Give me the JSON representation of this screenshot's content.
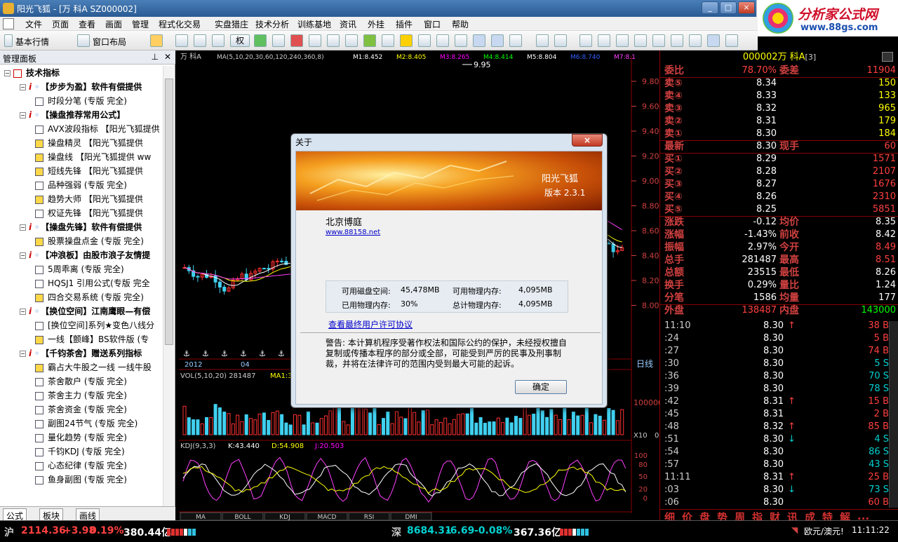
{
  "window": {
    "title": "阳光飞狐 - [万 科A SZ000002]",
    "controls": [
      "_",
      "□",
      "×"
    ]
  },
  "logo": {
    "text": "分析家公式网",
    "url": "www.88gs.com"
  },
  "menu": [
    "文件",
    "页面",
    "查看",
    "画面",
    "管理",
    "程式化交易",
    "实盘猎庄",
    "技术分析",
    "训练基地",
    "资讯",
    "外挂",
    "插件",
    "窗口",
    "帮助"
  ],
  "toolbar": {
    "market": "基本行情",
    "layout": "窗口布局",
    "quan": "权"
  },
  "panel": {
    "title": "管理面板",
    "tabs": [
      "公式",
      "板块",
      "画线"
    ],
    "tree": [
      {
        "lvl": 0,
        "type": "root",
        "text": "技术指标"
      },
      {
        "lvl": 1,
        "type": "group",
        "text": "【步步为盈】软件有偿提供"
      },
      {
        "lvl": 2,
        "type": "item",
        "text": "时段分笔  (专版 完全)"
      },
      {
        "lvl": 1,
        "type": "group",
        "text": "【操盘推荐常用公式】"
      },
      {
        "lvl": 2,
        "type": "item",
        "text": "AVX波段指标  【阳光飞狐提供"
      },
      {
        "lvl": 2,
        "type": "itemy",
        "text": "操盘精灵  【阳光飞狐提供 "
      },
      {
        "lvl": 2,
        "type": "itemy",
        "text": "操盘线  【阳光飞狐提供 ww"
      },
      {
        "lvl": 2,
        "type": "itemy",
        "text": "短线先锋  【阳光飞狐提供 "
      },
      {
        "lvl": 2,
        "type": "item",
        "text": "品种强弱  (专版 完全)"
      },
      {
        "lvl": 2,
        "type": "itemy",
        "text": "趋势大师  【阳光飞狐提供 "
      },
      {
        "lvl": 2,
        "type": "item",
        "text": "权证先锋  【阳光飞狐提供 "
      },
      {
        "lvl": 1,
        "type": "group",
        "text": "【操盘先锋】软件有偿提供"
      },
      {
        "lvl": 2,
        "type": "itemy",
        "text": "股票操盘点金  (专版 完全)"
      },
      {
        "lvl": 1,
        "type": "group",
        "text": "【冲浪板】由股市浪子友情提"
      },
      {
        "lvl": 2,
        "type": "item",
        "text": "5周乖离  (专版 完全)"
      },
      {
        "lvl": 2,
        "type": "item",
        "text": "HQSJ1  引用公式(专版 完全"
      },
      {
        "lvl": 2,
        "type": "itemy",
        "text": "四合交易系统  (专版 完全)"
      },
      {
        "lvl": 1,
        "type": "group",
        "text": "【换位空间】江南鹰眼—有偿"
      },
      {
        "lvl": 2,
        "type": "item",
        "text": "[换位空间]系列★变色八线分"
      },
      {
        "lvl": 2,
        "type": "itemy",
        "text": "一线【颤峰】BS软件版  (专"
      },
      {
        "lvl": 1,
        "type": "group",
        "text": "【千钧茶舍】赠送系列指标"
      },
      {
        "lvl": 2,
        "type": "itemy",
        "text": "霸占大牛股之一线  一线牛股"
      },
      {
        "lvl": 2,
        "type": "item",
        "text": "茶舍散户  (专版 完全)"
      },
      {
        "lvl": 2,
        "type": "item",
        "text": "茶舍主力  (专版 完全)"
      },
      {
        "lvl": 2,
        "type": "item",
        "text": "茶舍资金  (专版 完全)"
      },
      {
        "lvl": 2,
        "type": "item",
        "text": "副图24节气  (专版 完全)"
      },
      {
        "lvl": 2,
        "type": "item",
        "text": "量化趋势  (专版 完全)"
      },
      {
        "lvl": 2,
        "type": "item",
        "text": "千钧KDJ  (专版 完全)"
      },
      {
        "lvl": 2,
        "type": "item",
        "text": "心态纪律  (专版 完全)"
      },
      {
        "lvl": 2,
        "type": "item",
        "text": "鱼身副图  (专版 完全)"
      }
    ]
  },
  "chart": {
    "stock": "万  科A",
    "ma_label": "MA(5,10,20,30,60,120,240,360,8)",
    "ma": [
      {
        "t": "M1:8.452",
        "c": "#ffffff"
      },
      {
        "t": "M2:8.405",
        "c": "#ffff00"
      },
      {
        "t": "M3:8.265",
        "c": "#ff00ff"
      },
      {
        "t": "M4:8.414",
        "c": "#00ff00"
      },
      {
        "t": "M5:8.804",
        "c": "#ffffff"
      },
      {
        "t": "M6:8.740",
        "c": "#3060ff"
      },
      {
        "t": "M7:8.1",
        "c": "#ff40ff"
      }
    ],
    "high_label": "9.95",
    "price_axis": [
      "9.80",
      "9.60",
      "9.40",
      "9.20",
      "9.00",
      "8.80",
      "8.60",
      "8.40",
      "8.20",
      "8.00"
    ],
    "date_labels": [
      "2012",
      "04"
    ],
    "period": "日线",
    "vol_label": "VOL(5,10,20)  281487",
    "vol_ma1": "MA1:3",
    "vol_axis": "100000",
    "vol_unit": "X10",
    "vol_zero": "0",
    "kdj_label": "KDJ(9,3,3)",
    "kdj": [
      {
        "t": "K:43.440",
        "c": "#ffffff"
      },
      {
        "t": "D:54.908",
        "c": "#ffff00"
      },
      {
        "t": "J:20.503",
        "c": "#ff00ff"
      }
    ],
    "kdj_axis": [
      "100",
      "80",
      "50",
      "20",
      "0"
    ],
    "bottom_tabs": [
      "MA",
      "BOLL",
      "KDJ",
      "MACD",
      "RSI",
      "DMI"
    ]
  },
  "quote": {
    "title": "000002万 科A",
    "title_suffix": "[3]",
    "rows": [
      {
        "l": "委比",
        "v": "78.70%",
        "c": "#ff4040",
        "l2": "委差",
        "v2": "11904",
        "c2": "#ff4040"
      },
      {
        "l": "卖⑤",
        "v": "8.34",
        "c": "#ffffff",
        "v2": "150",
        "c2": "#ffff00"
      },
      {
        "l": "卖④",
        "v": "8.33",
        "c": "#ffffff",
        "v2": "133",
        "c2": "#ffff00"
      },
      {
        "l": "卖③",
        "v": "8.32",
        "c": "#ffffff",
        "v2": "965",
        "c2": "#ffff00"
      },
      {
        "l": "卖②",
        "v": "8.31",
        "c": "#ffffff",
        "v2": "179",
        "c2": "#ffff00"
      },
      {
        "l": "卖①",
        "v": "8.30",
        "c": "#ffffff",
        "v2": "184",
        "c2": "#ffff00"
      },
      {
        "l": "最新",
        "v": "8.30",
        "c": "#ffffff",
        "l2": "现手",
        "v2": "60",
        "c2": "#ff4040"
      },
      {
        "l": "买①",
        "v": "8.29",
        "c": "#ffffff",
        "v2": "1571",
        "c2": "#ff4040"
      },
      {
        "l": "买②",
        "v": "8.28",
        "c": "#ffffff",
        "v2": "2107",
        "c2": "#ff4040"
      },
      {
        "l": "买③",
        "v": "8.27",
        "c": "#ffffff",
        "v2": "1676",
        "c2": "#ff4040"
      },
      {
        "l": "买④",
        "v": "8.26",
        "c": "#ffffff",
        "v2": "2310",
        "c2": "#ff4040"
      },
      {
        "l": "买⑤",
        "v": "8.25",
        "c": "#ffffff",
        "v2": "5851",
        "c2": "#ff4040"
      },
      {
        "l": "涨跌",
        "v": "-0.12",
        "c": "#ffffff",
        "l2": "均价",
        "v2": "8.35",
        "c2": "#ffffff"
      },
      {
        "l": "涨幅",
        "v": "-1.43%",
        "c": "#ffffff",
        "l2": "前收",
        "v2": "8.42",
        "c2": "#ffffff"
      },
      {
        "l": "振幅",
        "v": "2.97%",
        "c": "#ffffff",
        "l2": "今开",
        "v2": "8.49",
        "c2": "#ff4040"
      },
      {
        "l": "总手",
        "v": "281487",
        "c": "#ffffff",
        "l2": "最高",
        "v2": "8.51",
        "c2": "#ff4040"
      },
      {
        "l": "总额",
        "v": "23515",
        "c": "#ffffff",
        "l2": "最低",
        "v2": "8.26",
        "c2": "#ffffff"
      },
      {
        "l": "换手",
        "v": "0.29%",
        "c": "#ffffff",
        "l2": "量比",
        "v2": "1.24",
        "c2": "#ffffff"
      },
      {
        "l": "分笔",
        "v": "1586",
        "c": "#ffffff",
        "l2": "均量",
        "v2": "177",
        "c2": "#ffffff"
      },
      {
        "l": "外盘",
        "v": "138487",
        "c": "#ff4040",
        "l2": "内盘",
        "v2": "143000",
        "c2": "#00ff00"
      }
    ],
    "ticks": [
      {
        "t": "11:10",
        "p": "8.30",
        "a": "↑",
        "dn": false,
        "v": "38 B",
        "c": "#ff4040"
      },
      {
        "t": ":24",
        "p": "8.30",
        "a": "",
        "dn": false,
        "v": "5 B",
        "c": "#ff4040"
      },
      {
        "t": ":27",
        "p": "8.30",
        "a": "",
        "dn": false,
        "v": "74 B",
        "c": "#ff4040"
      },
      {
        "t": ":30",
        "p": "8.30",
        "a": "",
        "dn": false,
        "v": "5 S",
        "c": "#00d0d0"
      },
      {
        "t": ":36",
        "p": "8.30",
        "a": "",
        "dn": false,
        "v": "70 S",
        "c": "#00d0d0"
      },
      {
        "t": ":39",
        "p": "8.30",
        "a": "",
        "dn": false,
        "v": "78 S",
        "c": "#00d0d0"
      },
      {
        "t": ":42",
        "p": "8.31",
        "a": "↑",
        "dn": false,
        "v": "15 B",
        "c": "#ff4040"
      },
      {
        "t": ":45",
        "p": "8.31",
        "a": "",
        "dn": false,
        "v": "2 B",
        "c": "#ff4040"
      },
      {
        "t": ":48",
        "p": "8.32",
        "a": "↑",
        "dn": false,
        "v": "85 B",
        "c": "#ff4040"
      },
      {
        "t": ":51",
        "p": "8.30",
        "a": "↓",
        "dn": true,
        "v": "4 S",
        "c": "#00d0d0"
      },
      {
        "t": ":54",
        "p": "8.30",
        "a": "",
        "dn": false,
        "v": "86 S",
        "c": "#00d0d0"
      },
      {
        "t": ":57",
        "p": "8.30",
        "a": "",
        "dn": false,
        "v": "43 S",
        "c": "#00d0d0"
      },
      {
        "t": "11:11",
        "p": "8.31",
        "a": "↑",
        "dn": false,
        "v": "25 B",
        "c": "#ff4040"
      },
      {
        "t": ":03",
        "p": "8.30",
        "a": "↓",
        "dn": true,
        "v": "73 S",
        "c": "#00d0d0"
      },
      {
        "t": ":06",
        "p": "8.30",
        "a": "",
        "dn": false,
        "v": "60 B",
        "c": "#ff4040"
      }
    ],
    "tabs": [
      "细",
      "价",
      "盘",
      "势",
      "周",
      "指",
      "财",
      "讯",
      "成",
      "特",
      "解",
      "..."
    ]
  },
  "status": {
    "sh_label": "沪",
    "sh_index": "2114.36",
    "sh_change": "+3.98",
    "sh_pct": "0.19%",
    "sh_amount": "380.44亿",
    "sz_label": "深",
    "sz_index": "8684.31",
    "sz_change": "-6.69",
    "sz_pct": "-0.08%",
    "sz_amount": "367.36亿",
    "fx": "欧元/澳元!",
    "time": "11:11:22"
  },
  "dialog": {
    "title": "关于",
    "close": "×",
    "product": "阳光飞狐",
    "version": "版本 2.3.1",
    "company": "北京博庭",
    "url": "www.88158.net",
    "disk_label": "可用磁盘空间:",
    "disk_value": "45,478MB",
    "phys_label": "可用物理内存:",
    "phys_value": "4,095MB",
    "used_label": "已用物理内存:",
    "used_value": "30%",
    "total_label": "总计物理内存:",
    "total_value": "4,095MB",
    "license": "查看最终用户许可协议",
    "warning": "警告: 本计算机程序受著作权法和国际公约的保护，未经授权擅自复制或传播本程序的部分或全部，可能受到严厉的民事及刑事制裁，并将在法律许可的范围内受到最大可能的起诉。",
    "ok": "确定"
  }
}
